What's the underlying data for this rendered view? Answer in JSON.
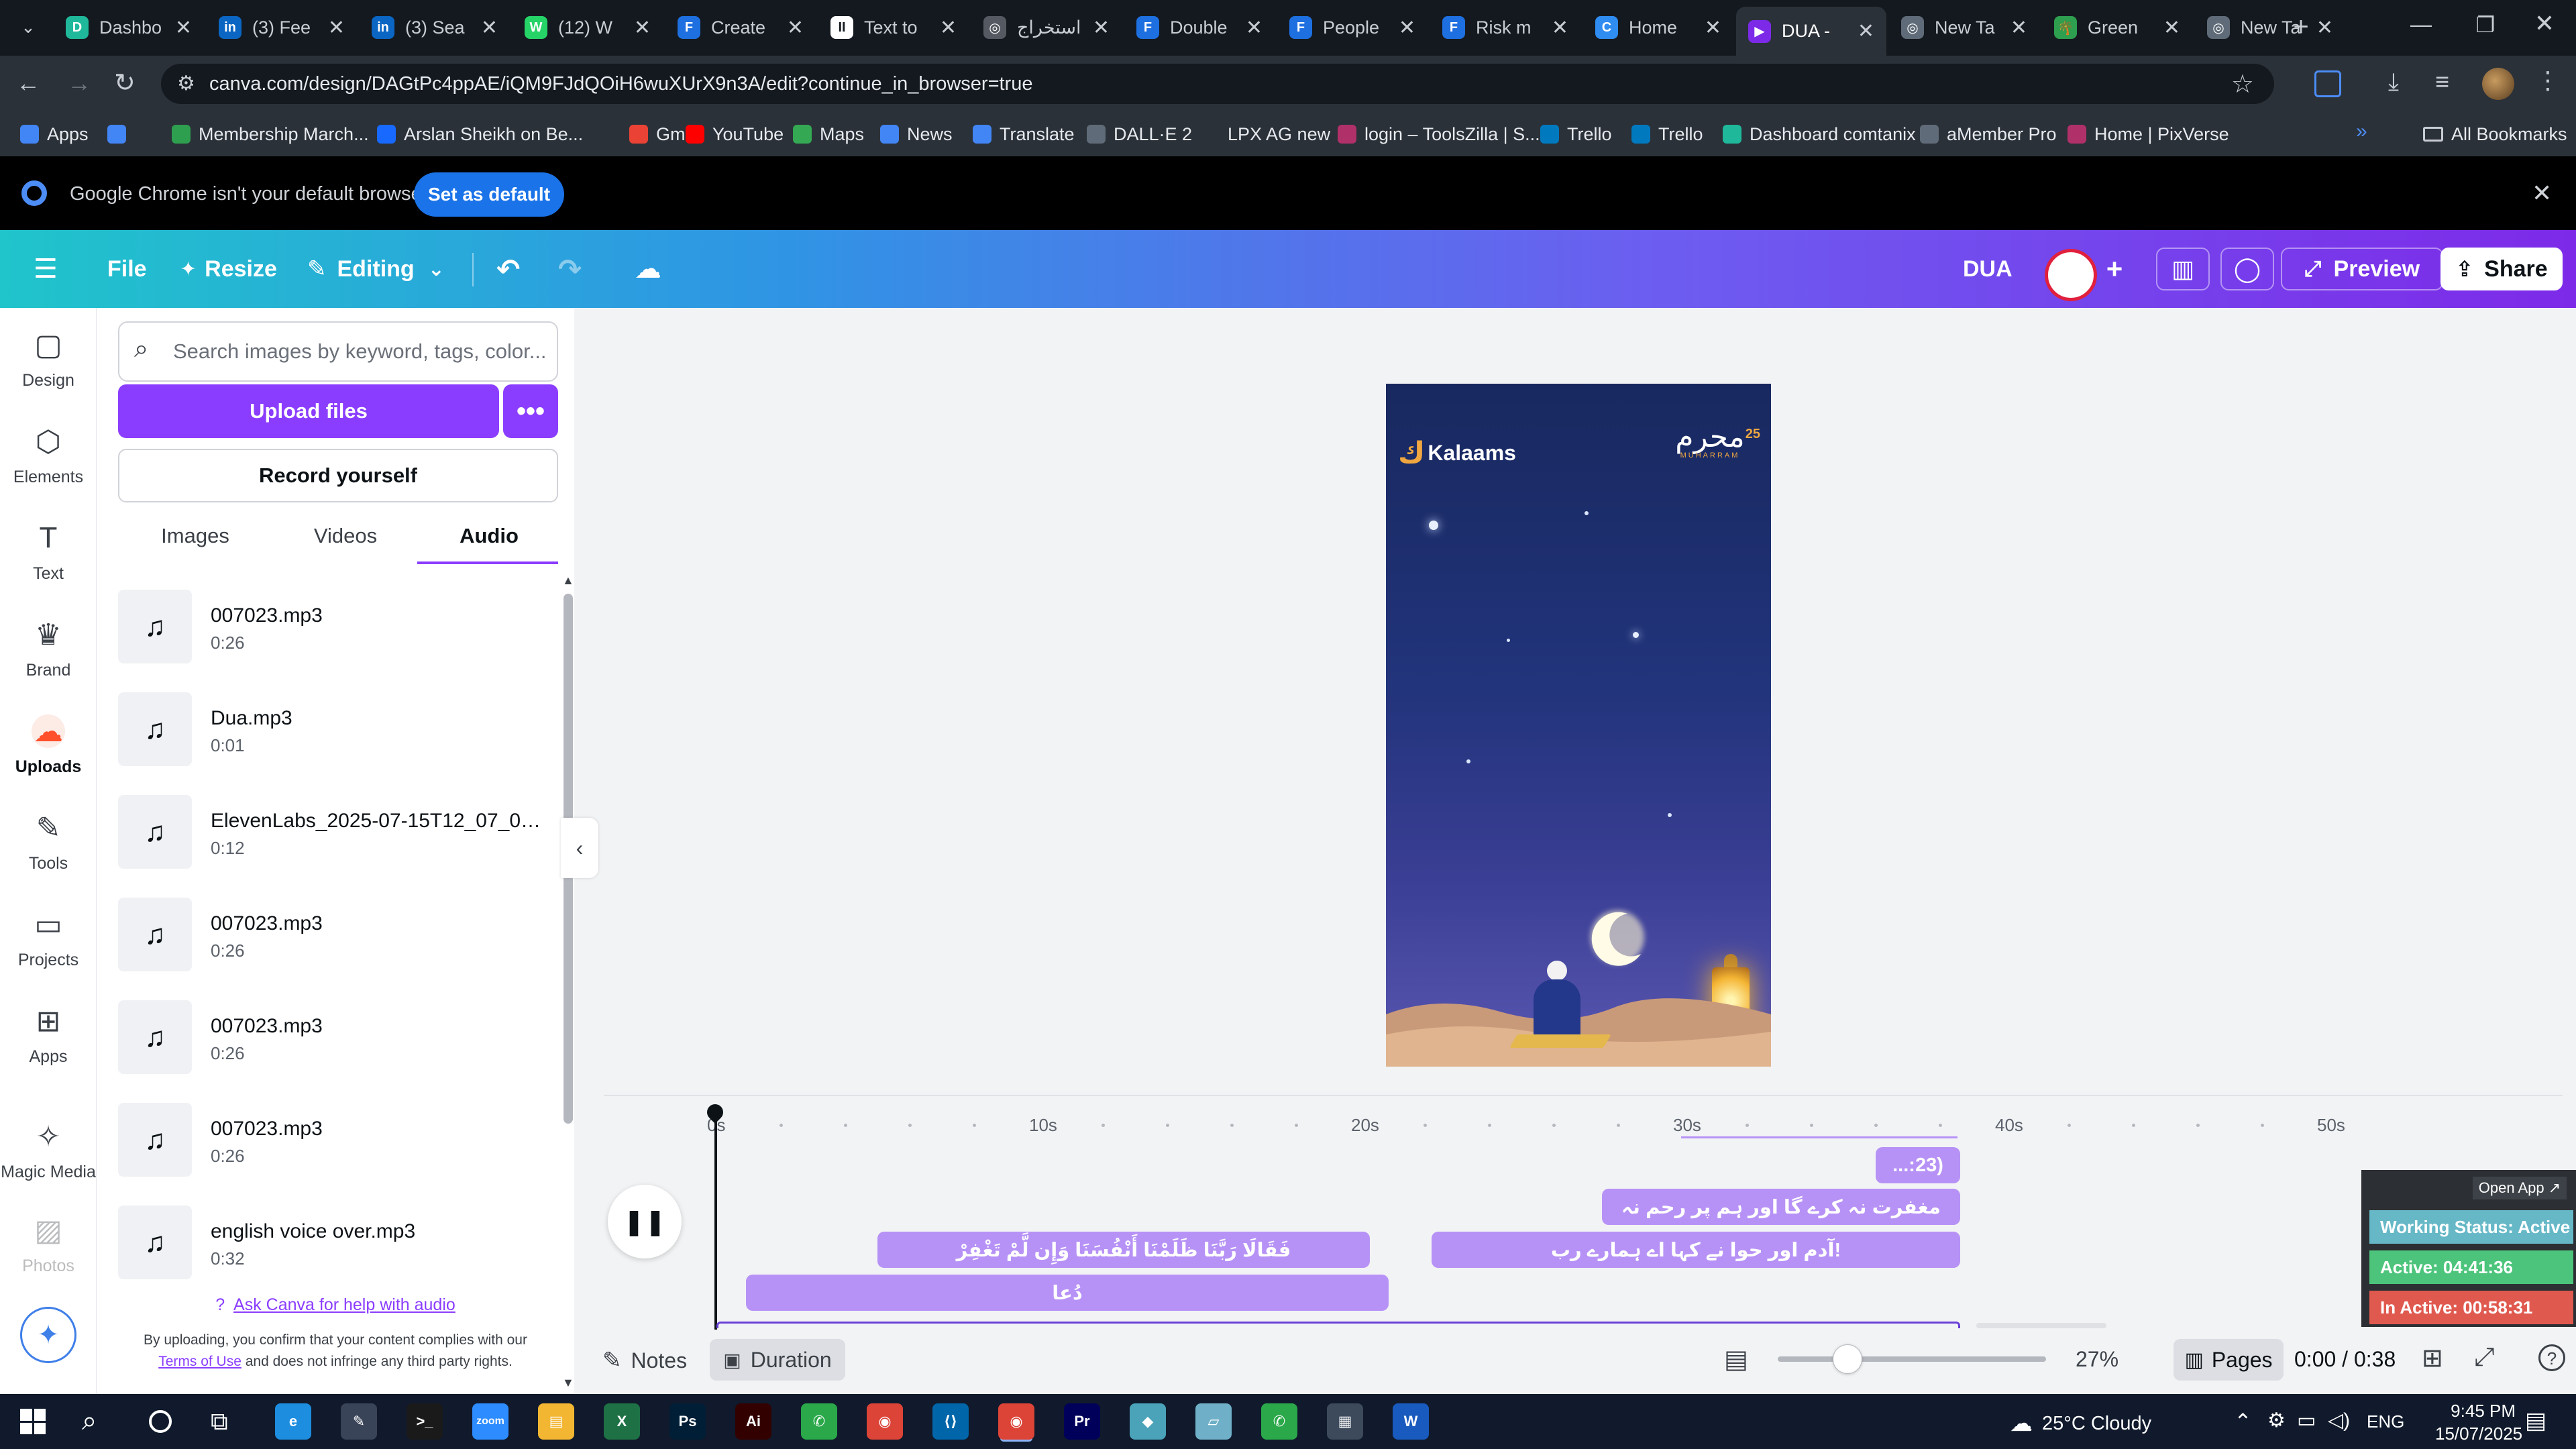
{
  "browser": {
    "tabs": [
      {
        "title": "Dashbo",
        "favicon_color": "#1fb89a",
        "favicon_letter": "D"
      },
      {
        "title": "(3) Fee",
        "favicon_color": "#0a66c2",
        "favicon_letter": "in"
      },
      {
        "title": "(3) Sea",
        "favicon_color": "#0a66c2",
        "favicon_letter": "in"
      },
      {
        "title": "(12) W",
        "favicon_color": "#25d366",
        "favicon_letter": "W"
      },
      {
        "title": "Create",
        "favicon_color": "#1e6fe0",
        "favicon_letter": "F"
      },
      {
        "title": "Text to",
        "favicon_color": "#ffffff",
        "favicon_letter": "II"
      },
      {
        "title": "استخراج",
        "favicon_color": "#555a62",
        "favicon_letter": "◎"
      },
      {
        "title": "Double",
        "favicon_color": "#1e6fe0",
        "favicon_letter": "F"
      },
      {
        "title": "People",
        "favicon_color": "#1e6fe0",
        "favicon_letter": "F"
      },
      {
        "title": "Risk m",
        "favicon_color": "#1e6fe0",
        "favicon_letter": "F"
      },
      {
        "title": "Home",
        "favicon_color": "#2f8cf0",
        "favicon_letter": "C"
      },
      {
        "title": "DUA -",
        "favicon_color": "#7d2ae8",
        "favicon_letter": "▶"
      },
      {
        "title": "New Ta",
        "favicon_color": "#5f6b78",
        "favicon_letter": "◎"
      },
      {
        "title": "Green",
        "favicon_color": "#2e9e4f",
        "favicon_letter": "🌴"
      },
      {
        "title": "New Ta",
        "favicon_color": "#5f6b78",
        "favicon_letter": "◎"
      }
    ],
    "active_tab_index": 11,
    "new_tab_label": "+",
    "url": "canva.com/design/DAGtPc4ppAE/iQM9FJdQOiH6wuXUrX9n3A/edit?continue_in_browser=true",
    "bookmarks": [
      {
        "label": "Apps",
        "color": "#4285f4"
      },
      {
        "label": "",
        "color": "#4285f4"
      },
      {
        "label": "Membership March...",
        "color": "#2e9e4f"
      },
      {
        "label": "Arslan Sheikh on Be...",
        "color": "#1769ff"
      },
      {
        "label": "Gmail",
        "color": "#ea4335"
      },
      {
        "label": "YouTube",
        "color": "#ff0000"
      },
      {
        "label": "Maps",
        "color": "#34a853"
      },
      {
        "label": "News",
        "color": "#4285f4"
      },
      {
        "label": "Translate",
        "color": "#4285f4"
      },
      {
        "label": "DALL·E 2",
        "color": "#5f6b78"
      },
      {
        "label": "LPX AG new",
        "color": "#2b3139"
      },
      {
        "label": "login – ToolsZilla | S...",
        "color": "#b0306a"
      },
      {
        "label": "Trello",
        "color": "#0079bf"
      },
      {
        "label": "Trello",
        "color": "#0079bf"
      },
      {
        "label": "Dashboard comtanix",
        "color": "#1fb89a"
      },
      {
        "label": "aMember Pro",
        "color": "#5f6b78"
      },
      {
        "label": "Home | PixVerse",
        "color": "#b0306a"
      }
    ],
    "all_bookmarks_label": "All Bookmarks",
    "infobar_text": "Google Chrome isn't your default browser",
    "set_default_label": "Set as default"
  },
  "canva_bar": {
    "file_label": "File",
    "resize_label": "Resize",
    "editing_label": "Editing",
    "doc_title": "DUA",
    "preview_label": "Preview",
    "share_label": "Share"
  },
  "rail": [
    {
      "label": "Design",
      "icon": "design-icon"
    },
    {
      "label": "Elements",
      "icon": "elements-icon"
    },
    {
      "label": "Text",
      "icon": "text-icon"
    },
    {
      "label": "Brand",
      "icon": "brand-icon"
    },
    {
      "label": "Uploads",
      "icon": "uploads-icon"
    },
    {
      "label": "Tools",
      "icon": "tools-icon"
    },
    {
      "label": "Projects",
      "icon": "projects-icon"
    },
    {
      "label": "Apps",
      "icon": "apps-icon"
    },
    {
      "label": "Magic Media",
      "icon": "magic-media-icon"
    },
    {
      "label": "Photos",
      "icon": "photos-icon"
    }
  ],
  "panel": {
    "search_placeholder": "Search images by keyword, tags, color...",
    "upload_label": "Upload files",
    "more_label": "•••",
    "record_label": "Record yourself",
    "tabs": [
      "Images",
      "Videos",
      "Audio"
    ],
    "selected_tab": "Audio",
    "audio_items": [
      {
        "name": "007023.mp3",
        "duration": "0:26"
      },
      {
        "name": "Dua.mp3",
        "duration": "0:01"
      },
      {
        "name": "ElevenLabs_2025-07-15T12_07_02_...",
        "duration": "0:12"
      },
      {
        "name": "007023.mp3",
        "duration": "0:26"
      },
      {
        "name": "007023.mp3",
        "duration": "0:26"
      },
      {
        "name": "007023.mp3",
        "duration": "0:26"
      },
      {
        "name": "english voice over.mp3",
        "duration": "0:32"
      }
    ],
    "help_link": "Ask Canva for help with audio",
    "disclaimer_pre": "By uploading, you confirm that your content complies with our",
    "terms_link": "Terms of Use",
    "disclaimer_post": "and does not infringe any third party rights."
  },
  "design": {
    "logo_text": "Kalaams",
    "badge_arabic": "محرم",
    "badge_number": "25",
    "badge_sub": "MUHARRAM"
  },
  "timeline": {
    "ticks": [
      "0s",
      "10s",
      "20s",
      "30s",
      "40s",
      "50s"
    ],
    "clips": [
      {
        "text": "(23:...",
        "row": 0
      },
      {
        "text": "مغفرت نہ کرے گا اور ہم پر رحم نہ",
        "row": 1
      },
      {
        "text": "فَقَالَا رَبَّنَا ظَلَمْنَا أَنْفُسَنَا وَإِن لَّمْ تَغْفِرْ",
        "row": 2
      },
      {
        "text": "!آدم اور حوا نے کہا اے ہمارے رب",
        "row": 2
      },
      {
        "text": "دُعا",
        "row": 3
      }
    ]
  },
  "bottom_bar": {
    "notes_label": "Notes",
    "duration_label": "Duration",
    "zoom": "27%",
    "pages_label": "Pages",
    "time_readout": "0:00 / 0:38",
    "zoom_fraction": 0.26
  },
  "widget": {
    "open_app": "Open App ↗",
    "working_status": "Working Status: Active",
    "active": "Active: 04:41:36",
    "inactive": "In Active: 00:58:31",
    "colors": {
      "working": "#66b8c7",
      "active": "#4cc47b",
      "inactive": "#e0594f"
    }
  },
  "taskbar": {
    "weather": "25°C  Cloudy",
    "language": "ENG",
    "time": "9:45 PM",
    "date": "15/07/2025",
    "apps": [
      {
        "name": "edge-icon",
        "color": "#1d8de0",
        "glyph": "e"
      },
      {
        "name": "pen-icon",
        "color": "#3a4458",
        "glyph": "✎"
      },
      {
        "name": "terminal-icon",
        "color": "#1a1a1a",
        "glyph": ">_"
      },
      {
        "name": "zoom-icon",
        "color": "#2d8cff",
        "glyph": "zoom"
      },
      {
        "name": "explorer-icon",
        "color": "#f2b632",
        "glyph": "▤"
      },
      {
        "name": "excel-icon",
        "color": "#1e7145",
        "glyph": "X"
      },
      {
        "name": "photoshop-icon",
        "color": "#001e36",
        "glyph": "Ps"
      },
      {
        "name": "illustrator-icon",
        "color": "#330000",
        "glyph": "Ai"
      },
      {
        "name": "green-app-icon",
        "color": "#2aa84a",
        "glyph": "✆"
      },
      {
        "name": "chrome-icon",
        "color": "#db4437",
        "glyph": "◉"
      },
      {
        "name": "vscode-icon",
        "color": "#0065a9",
        "glyph": "⟨⟩"
      },
      {
        "name": "chrome-active-icon",
        "color": "#db4437",
        "glyph": "◉"
      },
      {
        "name": "premiere-icon",
        "color": "#00005b",
        "glyph": "Pr"
      },
      {
        "name": "app-diamond-icon",
        "color": "#4aa3b8",
        "glyph": "◆"
      },
      {
        "name": "app-folder-icon",
        "color": "#6fb0c8",
        "glyph": "▱"
      },
      {
        "name": "green-app2-icon",
        "color": "#2aa84a",
        "glyph": "✆"
      },
      {
        "name": "calculator-icon",
        "color": "#3c4a5c",
        "glyph": "▦"
      },
      {
        "name": "word-icon",
        "color": "#185abd",
        "glyph": "W"
      }
    ]
  }
}
